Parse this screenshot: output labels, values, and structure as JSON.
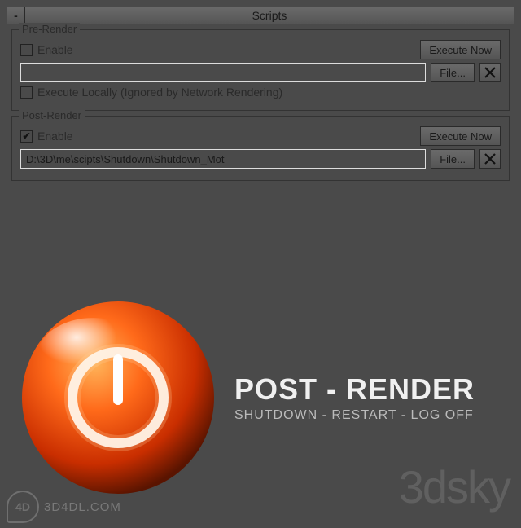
{
  "header": {
    "collapse_glyph": "-",
    "title": "Scripts"
  },
  "pre": {
    "legend": "Pre-Render",
    "enable_label": "Enable",
    "enable_checked": "",
    "execute_now_label": "Execute Now",
    "path_value": "",
    "file_btn_label": "File...",
    "execute_locally_label": "Execute Locally (Ignored by Network Rendering)",
    "execute_locally_checked": ""
  },
  "post": {
    "legend": "Post-Render",
    "enable_label": "Enable",
    "enable_checked": "✔",
    "execute_now_label": "Execute Now",
    "path_value": "D:\\3D\\me\\scipts\\Shutdown\\Shutdown_Mot",
    "file_btn_label": "File..."
  },
  "promo": {
    "title": "POST - RENDER",
    "subtitle": "SHUTDOWN - RESTART - LOG OFF"
  },
  "watermarks": {
    "sky": "3dsky",
    "d4dl_logo": "4D",
    "d4dl_text": "3D4DL.COM"
  }
}
